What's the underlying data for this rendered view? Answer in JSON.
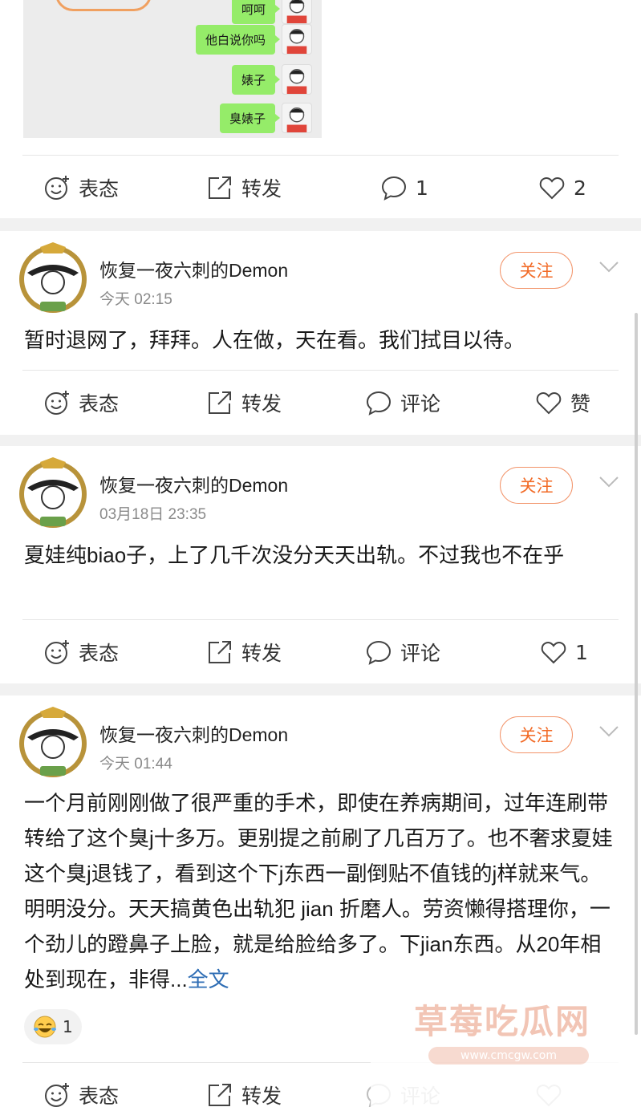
{
  "chat_screenshot": {
    "messages": [
      "呵呵",
      "他白说你吗",
      "婊子",
      "臭婊子"
    ]
  },
  "post0": {
    "actions": {
      "react": "表态",
      "repost": "转发",
      "comment_count": "1",
      "like_count": "2"
    }
  },
  "posts": [
    {
      "user": "恢复一夜六刺的Demon",
      "time": "今天 02:15",
      "follow": "关注",
      "text": "暂时退网了，拜拜。人在做，天在看。我们拭目以待。",
      "actions": {
        "react": "表态",
        "repost": "转发",
        "comment": "评论",
        "like": "赞"
      }
    },
    {
      "user": "恢复一夜六刺的Demon",
      "time": "03月18日 23:35",
      "follow": "关注",
      "text": "夏娃纯biao子，上了几千次没分天天出轨。不过我也不在乎",
      "actions": {
        "react": "表态",
        "repost": "转发",
        "comment": "评论",
        "like": "1"
      }
    },
    {
      "user": "恢复一夜六刺的Demon",
      "time": "今天 01:44",
      "follow": "关注",
      "text": "一个月前刚刚做了很严重的手术，即使在养病期间，过年连刷带转给了这个臭j十多万。更别提之前刷了几百万了。也不奢求夏娃这个臭j退钱了，看到这个下j东西一副倒贴不值钱的j样就来气。明明没分。天天搞黄色出轨犯 jian 折磨人。劳资懒得搭理你，一个劲儿的蹬鼻子上脸，就是给脸给多了。下jian东西。从20年相处到现在，非得...",
      "more": "全文",
      "reaction_count": "1",
      "actions": {
        "react": "表态",
        "repost": "转发",
        "comment": "评论"
      }
    }
  ],
  "watermark": {
    "title": "草莓吃瓜网",
    "url": "www.cmcgw.com"
  },
  "colors": {
    "follow": "#f26b27",
    "link": "#2e6db4",
    "bubble": "#95ec69"
  }
}
